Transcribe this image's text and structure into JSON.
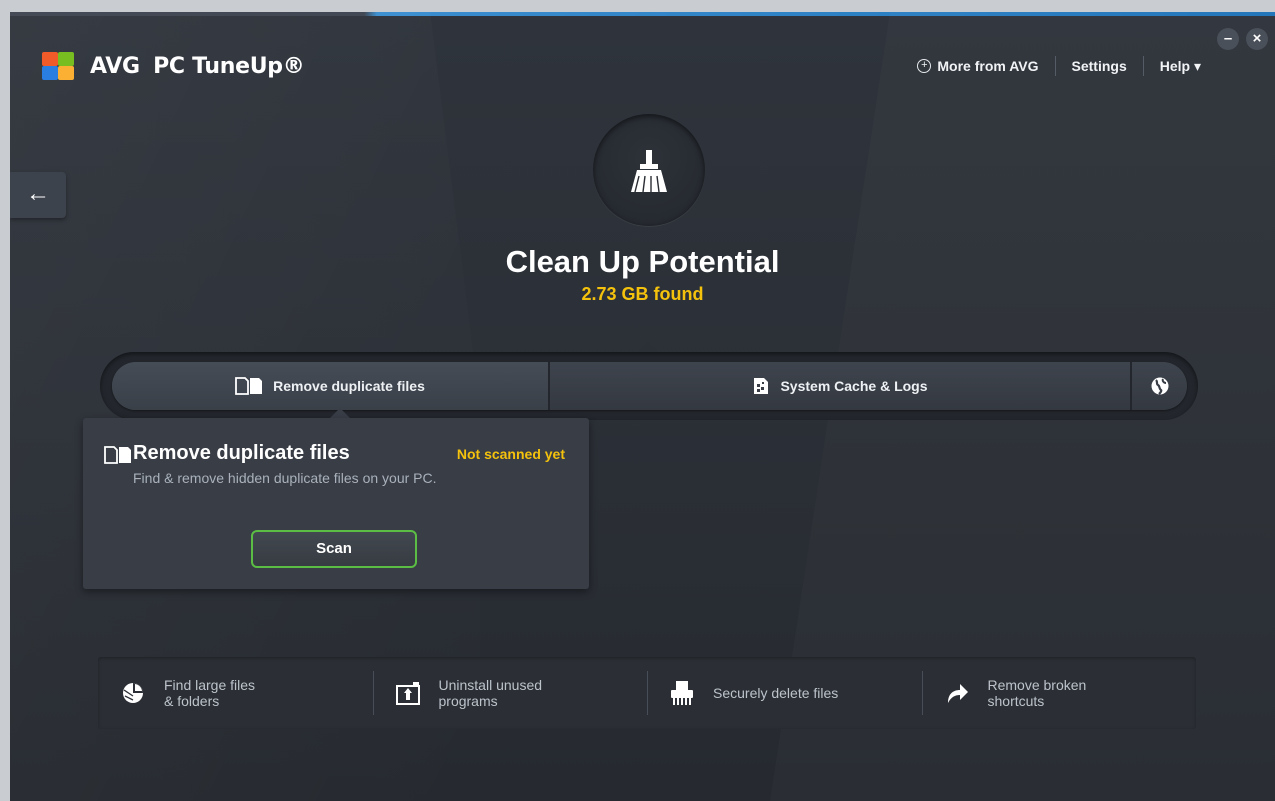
{
  "app": {
    "brand": "AVG",
    "product": "PC TuneUp®"
  },
  "nav": {
    "more": "More from AVG",
    "settings": "Settings",
    "help": "Help ▾"
  },
  "window": {
    "minimize": "–",
    "close": "×"
  },
  "back_label": "←",
  "hero": {
    "icon": "broom-icon",
    "title": "Clean Up Potential",
    "found": "2.73 GB found"
  },
  "tabs": [
    {
      "label": "Remove duplicate files",
      "icon": "duplicate-files-icon",
      "active": true
    },
    {
      "label": "System Cache & Logs",
      "icon": "cache-logs-icon",
      "active": false
    },
    {
      "label": "",
      "icon": "globe-icon",
      "active": false
    }
  ],
  "panel": {
    "title": "Remove duplicate files",
    "status": "Not scanned yet",
    "description": "Find & remove hidden duplicate files on your PC.",
    "button": "Scan"
  },
  "tools": [
    {
      "label": "Find large files\n& folders",
      "icon": "pie-chart-icon"
    },
    {
      "label": "Uninstall unused\nprograms",
      "icon": "uninstall-box-icon"
    },
    {
      "label": "Securely delete files",
      "icon": "shredder-icon"
    },
    {
      "label": "Remove broken\nshortcuts",
      "icon": "shortcut-arrow-icon"
    }
  ],
  "colors": {
    "accent_yellow": "#f4c20d",
    "scan_green": "#5bbd44",
    "background": "#2f343c",
    "top_blue": "#1f74b9"
  }
}
